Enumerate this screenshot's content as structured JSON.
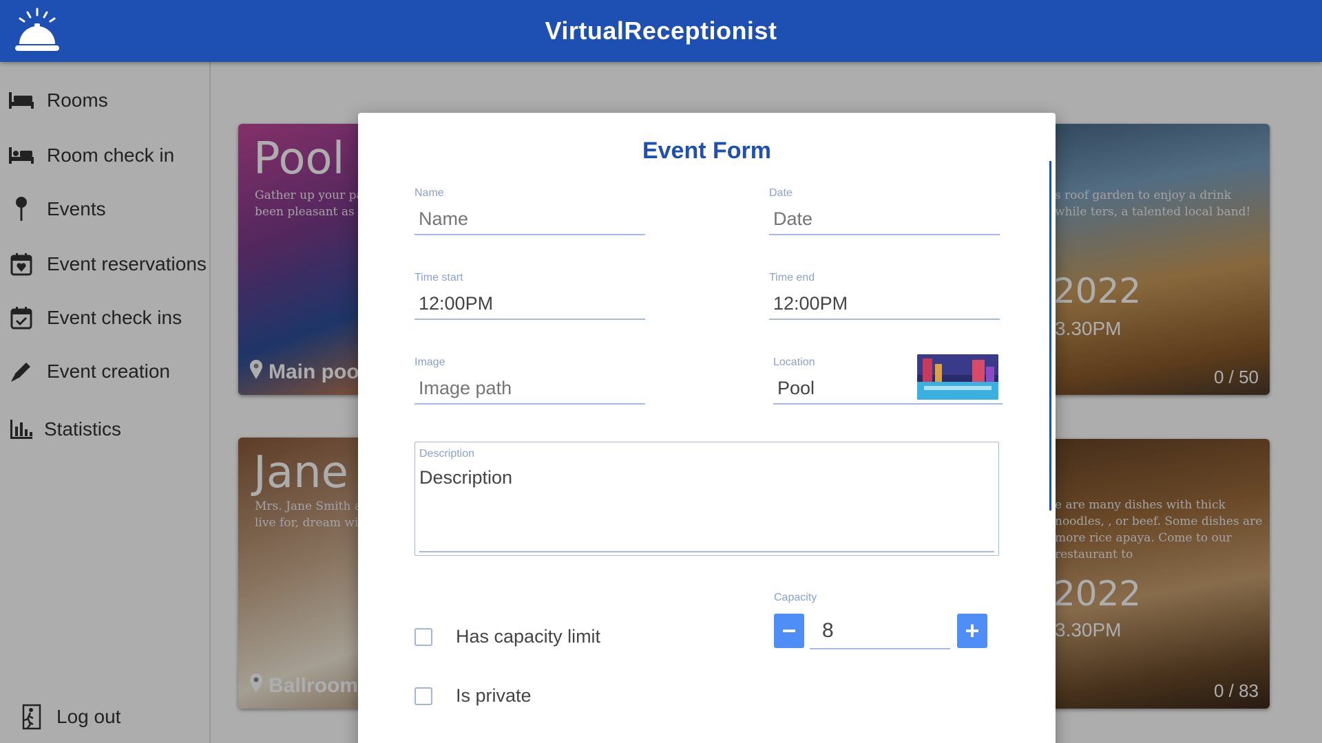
{
  "app": {
    "title": "VirtualReceptionist"
  },
  "sidebar": {
    "items": [
      {
        "label": "Rooms",
        "icon": "bed-icon"
      },
      {
        "label": "Room check in",
        "icon": "bed-checkin-icon"
      },
      {
        "label": "Events",
        "icon": "pin-icon"
      },
      {
        "label": "Event reservations",
        "icon": "calendar-heart-icon"
      },
      {
        "label": "Event check ins",
        "icon": "calendar-check-icon"
      },
      {
        "label": "Event creation",
        "icon": "pen-icon"
      },
      {
        "label": "Statistics",
        "icon": "bar-chart-icon"
      }
    ],
    "logout": {
      "label": "Log out",
      "icon": "exit-icon"
    }
  },
  "cards": [
    {
      "title": "Pool p",
      "desc": "Gather up your pa sumptuous two-co has been pleasant as your private DJ",
      "place": "Main poo"
    },
    {
      "title": "Jane &",
      "desc": "Mrs. Jane Smith ar exchange their ma live for, dream wit",
      "place": "Ballroom"
    },
    {
      "desc": "s roof garden to enjoy a drink while ters, a talented local band!",
      "date": "2022",
      "time": "3.30PM",
      "count": "0 / 50"
    },
    {
      "desc": "e are many dishes with thick noodles, , or beef. Some dishes are more rice apaya. Come to our restaurant to",
      "date": "2022",
      "time": "3.30PM",
      "count": "0 / 83"
    }
  ],
  "form": {
    "title": "Event Form",
    "name": {
      "label": "Name",
      "placeholder": "Name"
    },
    "date": {
      "label": "Date",
      "placeholder": "Date"
    },
    "time_start": {
      "label": "Time start",
      "value": "12:00PM"
    },
    "time_end": {
      "label": "Time end",
      "value": "12:00PM"
    },
    "image": {
      "label": "Image",
      "placeholder": "Image path"
    },
    "location": {
      "label": "Location",
      "value": "Pool"
    },
    "description": {
      "label": "Description",
      "placeholder": "Description"
    },
    "has_capacity_limit": {
      "label": "Has capacity limit",
      "checked": false
    },
    "is_private": {
      "label": "Is private",
      "checked": false
    },
    "capacity": {
      "label": "Capacity",
      "value": "8",
      "minus": "−",
      "plus": "+"
    }
  },
  "colors": {
    "brand": "#1e4fb3",
    "accent": "#4f8ef7",
    "field_line": "#a9b6e8",
    "label": "#8aa0d8"
  }
}
